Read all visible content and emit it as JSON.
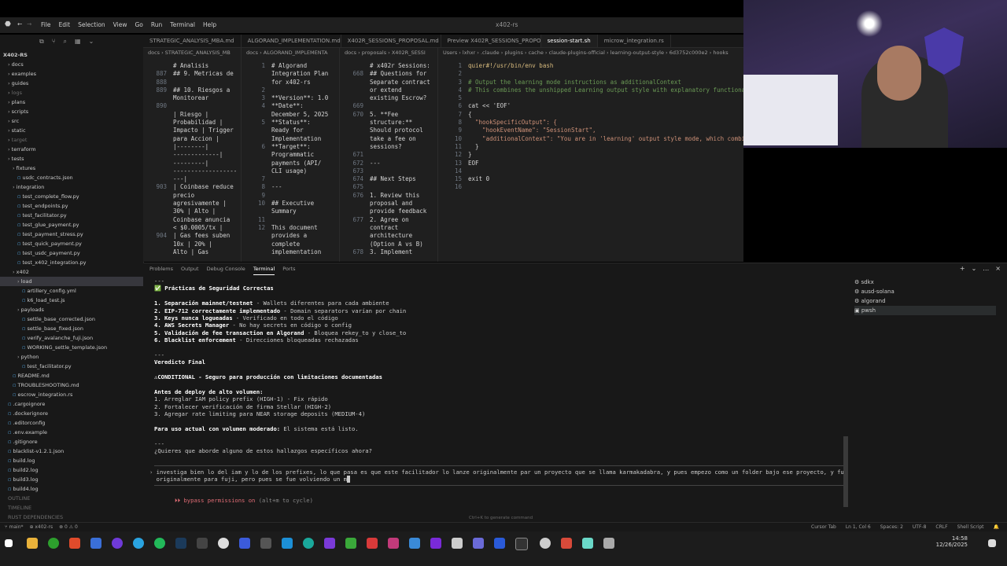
{
  "window": {
    "title": "x402-rs",
    "menu": [
      "File",
      "Edit",
      "Selection",
      "View",
      "Go",
      "Run",
      "Terminal",
      "Help"
    ]
  },
  "tabs": [
    {
      "label": "STRATEGIC_ANALYSIS_MBA.md"
    },
    {
      "label": "ALGORAND_IMPLEMENTATION.md"
    },
    {
      "label": "X402R_SESSIONS_PROPOSAL.md"
    },
    {
      "label": "Preview X402R_SESSIONS_PROPOSAL.md"
    },
    {
      "label": "session-start.sh",
      "active": true
    },
    {
      "label": "microw_integration.rs"
    }
  ],
  "sidebar": {
    "root": "X402-RS",
    "items": [
      "docs",
      "examples",
      "guides",
      "logs",
      "plans",
      "scripts",
      "src",
      "static",
      "target",
      "terraform",
      "tests",
      "fixtures",
      "usdc_contracts.json",
      "integration",
      "test_complete_flow.py",
      "test_endpoints.py",
      "test_facilitator.py",
      "test_glue_payment.py",
      "test_payment_stress.py",
      "test_quick_payment.py",
      "test_usdc_payment.py",
      "test_x402_integration.py",
      "x402",
      "load",
      "artillery_config.yml",
      "k6_load_test.js",
      "payloads",
      "settle_base_corrected.json",
      "settle_base_fixed.json",
      "verify_avalanche_fuji.json",
      "WORKING_settle_template.json",
      "python",
      "test_facilitator.py",
      "README.md",
      "TROUBLESHOOTING.md",
      "escrow_integration.rs",
      ".cargoignore",
      ".dockerignore",
      ".editorconfig",
      ".env.example",
      ".gitignore",
      "blacklist-v1.2.1.json",
      "build.log",
      "build2.log",
      "build3.log",
      "build4.log"
    ],
    "footer": [
      "OUTLINE",
      "TIMELINE",
      "RUST DEPENDENCIES"
    ]
  },
  "editors": {
    "pane1": {
      "crumb": "docs › STRATEGIC_ANALYSIS_MB",
      "lines": [
        [
          "",
          "# Analisis"
        ],
        [
          "887",
          "## 9. Metricas de"
        ],
        [
          "888",
          ""
        ],
        [
          "889",
          "## 10. Riesgos a"
        ],
        [
          "",
          "Monitorear"
        ],
        [
          "890",
          ""
        ],
        [
          "",
          "| Riesgo |"
        ],
        [
          "",
          "Probabilidad |"
        ],
        [
          "",
          "Impacto | Trigger"
        ],
        [
          "",
          "para Accion |"
        ],
        [
          "",
          "|--------|"
        ],
        [
          "",
          "-------------|"
        ],
        [
          "",
          "---------|"
        ],
        [
          "",
          "------------------"
        ],
        [
          "",
          "---|"
        ],
        [
          "903",
          "| Coinbase reduce"
        ],
        [
          "",
          "precio"
        ],
        [
          "",
          "agresivamente |"
        ],
        [
          "",
          "30% | Alto |"
        ],
        [
          "",
          "Coinbase anuncia"
        ],
        [
          "",
          "< $0.0005/tx |"
        ],
        [
          "904",
          "| Gas fees suben"
        ],
        [
          "",
          "10x | 20% |"
        ],
        [
          "",
          "Alto | Gas"
        ]
      ]
    },
    "pane2": {
      "crumb": "docs › ALGORAND_IMPLEMENTA",
      "lines": [
        [
          "1",
          "# Algorand"
        ],
        [
          "",
          "Integration Plan"
        ],
        [
          "",
          "for x402-rs"
        ],
        [
          "2",
          ""
        ],
        [
          "3",
          "**Version**: 1.0"
        ],
        [
          "4",
          "**Date**:"
        ],
        [
          "",
          "December 5, 2025"
        ],
        [
          "5",
          "**Status**:"
        ],
        [
          "",
          "Ready for"
        ],
        [
          "",
          "Implementation"
        ],
        [
          "6",
          "**Target**:"
        ],
        [
          "",
          "Programmatic"
        ],
        [
          "",
          "payments (API/"
        ],
        [
          "",
          "CLI usage)"
        ],
        [
          "7",
          ""
        ],
        [
          "8",
          "---"
        ],
        [
          "9",
          ""
        ],
        [
          "10",
          "## Executive"
        ],
        [
          "",
          "Summary"
        ],
        [
          "11",
          ""
        ],
        [
          "12",
          "This document"
        ],
        [
          "",
          "provides a"
        ],
        [
          "",
          "complete"
        ],
        [
          "",
          "implementation"
        ]
      ]
    },
    "pane3": {
      "crumb": "docs › proposals › X402R_SESSI",
      "lines": [
        [
          "",
          "# x402r Sessions:"
        ],
        [
          "668",
          "## Questions for"
        ],
        [
          "",
          "Separate contract"
        ],
        [
          "",
          "or extend"
        ],
        [
          "",
          "existing Escrow?"
        ],
        [
          "669",
          ""
        ],
        [
          "670",
          "5. **Fee"
        ],
        [
          "",
          "structure:**"
        ],
        [
          "",
          "Should protocol"
        ],
        [
          "",
          "take a fee on"
        ],
        [
          "",
          "sessions?"
        ],
        [
          "671",
          ""
        ],
        [
          "672",
          "---"
        ],
        [
          "673",
          ""
        ],
        [
          "674",
          "## Next Steps"
        ],
        [
          "675",
          ""
        ],
        [
          "676",
          "1. Review this"
        ],
        [
          "",
          "proposal and"
        ],
        [
          "",
          "provide feedback"
        ],
        [
          "677",
          "2. Agree on"
        ],
        [
          "",
          "contract"
        ],
        [
          "",
          "architecture"
        ],
        [
          "",
          "(Option A vs B)"
        ],
        [
          "678",
          "3. Implement"
        ]
      ]
    },
    "pane4": {
      "crumb": "Users › lxhxr › .claude › plugins › cache › claude-plugins-official › learning-output-style › 6d3752c000e2 › hooks",
      "lines": [
        [
          "1",
          "quier#!/usr/bin/env bash"
        ],
        [
          "2",
          ""
        ],
        [
          "3",
          "# Output the learning mode instructions as additionalContext"
        ],
        [
          "4",
          "# This combines the unshipped Learning output style with explanatory functionality"
        ],
        [
          "5",
          ""
        ],
        [
          "6",
          "cat << 'EOF'"
        ],
        [
          "7",
          "{"
        ],
        [
          "8",
          "  \"hookSpecificOutput\": {"
        ],
        [
          "9",
          "    \"hookEventName\": \"SessionStart\","
        ],
        [
          "10",
          "    \"additionalContext\": \"You are in 'learning' output style mode, which combines in"
        ],
        [
          "11",
          "  }"
        ],
        [
          "12",
          "}"
        ],
        [
          "13",
          "EOF"
        ],
        [
          "14",
          ""
        ],
        [
          "15",
          "exit 0"
        ],
        [
          "16",
          ""
        ]
      ]
    }
  },
  "panel": {
    "tabs": [
      "Problems",
      "Output",
      "Debug Console",
      "Terminal",
      "Ports"
    ],
    "active_tab": "Terminal",
    "terminal_lines": [
      {
        "text": "---"
      },
      {
        "text": "✅ Prácticas de Seguridad Correctas",
        "bold": true
      },
      {
        "text": ""
      },
      {
        "bold_part": "1. Separación mainnet/testnet",
        "rest": " - Wallets diferentes para cada ambiente"
      },
      {
        "bold_part": "2. EIP-712 correctamente implementado",
        "rest": " - Domain separators varían por chain"
      },
      {
        "bold_part": "3. Keys nunca logueadas",
        "rest": " - Verificado en todo el código"
      },
      {
        "bold_part": "4. AWS Secrets Manager",
        "rest": " - No hay secrets en código o config"
      },
      {
        "bold_part": "5. Validación de fee transaction en Algorand",
        "rest": " - Bloquea rekey_to y close_to"
      },
      {
        "bold_part": "6. Blacklist enforcement",
        "rest": " - Direcciones bloqueadas rechazadas"
      },
      {
        "text": ""
      },
      {
        "text": "---"
      },
      {
        "text": "Veredicto Final",
        "bold": true
      },
      {
        "text": ""
      },
      {
        "text": "⚠CONDITIONAL - Seguro para producción con limitaciones documentadas",
        "bold": true
      },
      {
        "text": ""
      },
      {
        "text": "Antes de deploy de alto volumen:",
        "bold": true
      },
      {
        "text": "1. Arreglar IAM policy prefix (HIGH-1) - Fix rápido"
      },
      {
        "text": "2. Fortalecer verificación de firma Stellar (HIGH-2)"
      },
      {
        "text": "3. Agregar rate limiting para NEAR storage deposits (MEDIUM-4)"
      },
      {
        "text": ""
      },
      {
        "bold_part": "Para uso actual con volumen moderado:",
        "rest": " El sistema está listo."
      },
      {
        "text": ""
      },
      {
        "text": "---"
      },
      {
        "text": "¿Quieres que aborde alguno de estos hallazgos específicos ahora?"
      }
    ],
    "prompt_line1": "investiga bien lo del iam y lo de los prefixes, lo que pasa es que este facilitador lo lanze originalmente par un proyecto que se llama karmakadabra, y pues empezo como un folder bajo ese proyecto, y fue",
    "prompt_line2": "originalmente para fuji, pero pues se fue volviendo un m",
    "bypass": "bypass permissions on",
    "bypass_hint": "(alt+m to cycle)",
    "generate_hint": "Ctrl+K to generate command",
    "terminals": [
      "sdkx",
      "ausd-solana",
      "algorand",
      "pwsh"
    ]
  },
  "statusbar": {
    "branch": "main*",
    "project": "x402-rs",
    "problems": "⊗ 0 ⚠ 0",
    "right": [
      "Cursor Tab",
      "Ln 1, Col 6",
      "Spaces: 2",
      "UTF-8",
      "CRLF",
      "Shell Script"
    ]
  },
  "taskbar": {
    "time": "14:58",
    "date": "12/26/2025"
  }
}
